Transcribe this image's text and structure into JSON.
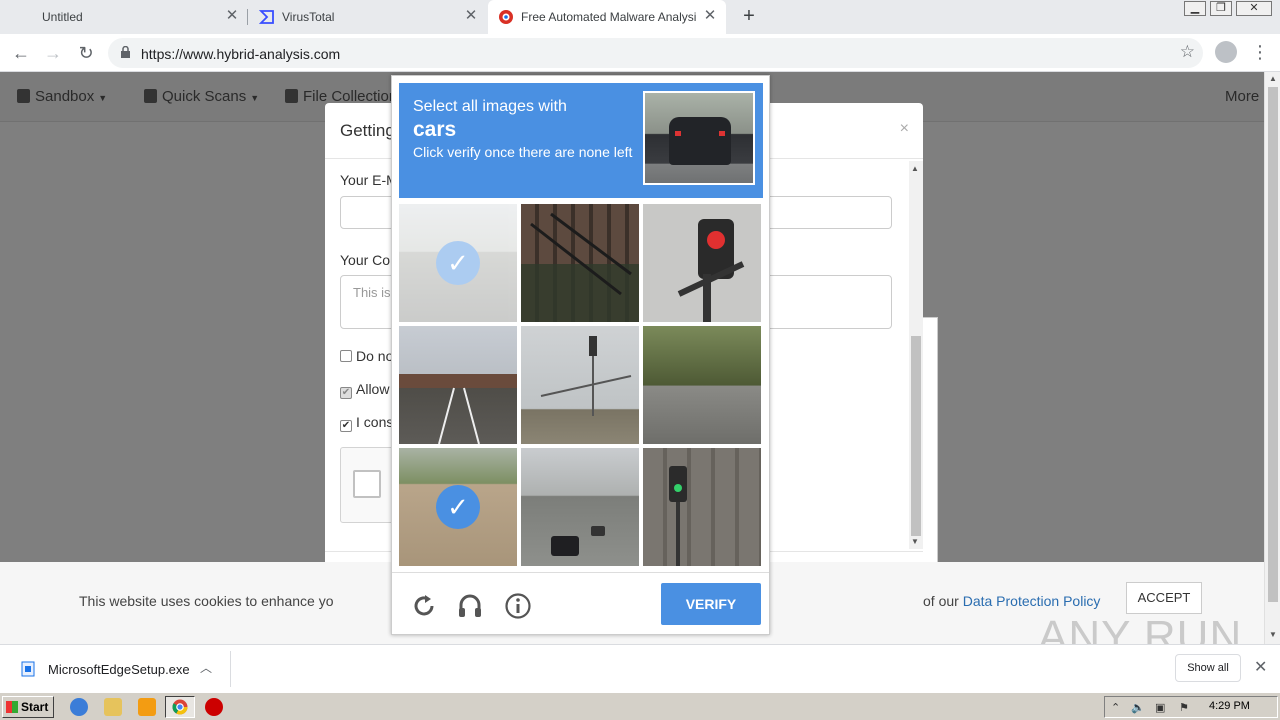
{
  "browser": {
    "tabs": [
      {
        "title": "Untitled",
        "active": false
      },
      {
        "title": "VirusTotal",
        "active": false
      },
      {
        "title": "Free Automated Malware Analysis Se",
        "active": true
      }
    ],
    "url": "https://www.hybrid-analysis.com",
    "colors": {
      "tabstrip": "#e8eaed",
      "accent": "#4a90e2"
    }
  },
  "site_nav": {
    "items": [
      {
        "label": "Sandbox",
        "icon": "cube-icon"
      },
      {
        "label": "Quick Scans",
        "icon": "file-scan-icon"
      },
      {
        "label": "File Collection",
        "icon": "files-icon"
      }
    ],
    "more": "More"
  },
  "modal": {
    "title": "Getting",
    "email_label": "Your E-M",
    "comment_label": "Your Cor",
    "comment_placeholder": "This is",
    "checks": [
      {
        "label": "Do no",
        "checked": false,
        "disabled": false
      },
      {
        "label": "Allow",
        "checked": true,
        "disabled": true
      },
      {
        "label": "I cons",
        "checked": true,
        "disabled": false
      }
    ]
  },
  "cookie_bar": {
    "text": "This website uses cookies to enhance yo",
    "text_tail": "of our",
    "link": "Data Protection Policy",
    "accept": "ACCEPT"
  },
  "captcha": {
    "line1": "Select all images with",
    "target": "cars",
    "line3": "Click verify once there are none left",
    "verify": "VERIFY",
    "icons": [
      "reload-icon",
      "audio-icon",
      "info-icon"
    ],
    "tiles": [
      {
        "subject": "highway-road",
        "selected": true
      },
      {
        "subject": "building-fire-escape",
        "selected": false
      },
      {
        "subject": "traffic-light-red",
        "selected": false
      },
      {
        "subject": "overpass-road",
        "selected": false
      },
      {
        "subject": "street-intersection",
        "selected": false
      },
      {
        "subject": "sidewalk-bicycle",
        "selected": false
      },
      {
        "subject": "highway-bridge",
        "selected": true
      },
      {
        "subject": "street-with-cars",
        "selected": false
      },
      {
        "subject": "traffic-light-green",
        "selected": false
      }
    ]
  },
  "watermark": "ANY RUN",
  "download_bar": {
    "file": "MicrosoftEdgeSetup.exe",
    "show_all": "Show all"
  },
  "taskbar": {
    "start": "Start",
    "clock": "4:29 PM"
  }
}
